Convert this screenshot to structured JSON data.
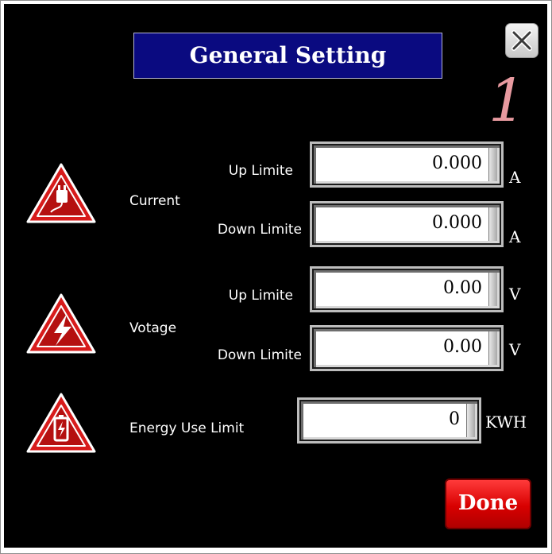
{
  "dialog": {
    "title": "General Setting",
    "annotation_mark": "1"
  },
  "current": {
    "group_label": "Current",
    "up": {
      "label": "Up Limite",
      "value": "0.000",
      "unit": "A"
    },
    "down": {
      "label": "Down Limite",
      "value": "0.000",
      "unit": "A"
    },
    "icon": "plug-warning-icon"
  },
  "voltage": {
    "group_label": "Votage",
    "up": {
      "label": "Up Limite",
      "value": "0.00",
      "unit": "V"
    },
    "down": {
      "label": "Down Limite",
      "value": "0.00",
      "unit": "V"
    },
    "icon": "lightning-warning-icon"
  },
  "energy": {
    "label": "Energy Use Limit",
    "value": "0",
    "unit": "KWH",
    "icon": "battery-warning-icon"
  },
  "buttons": {
    "done_label": "Done",
    "close_icon": "close-icon"
  },
  "colors": {
    "background": "#000000",
    "title_bg": "#0a0a80",
    "warning_red": "#d81c1c",
    "done_red": "#e00000"
  }
}
